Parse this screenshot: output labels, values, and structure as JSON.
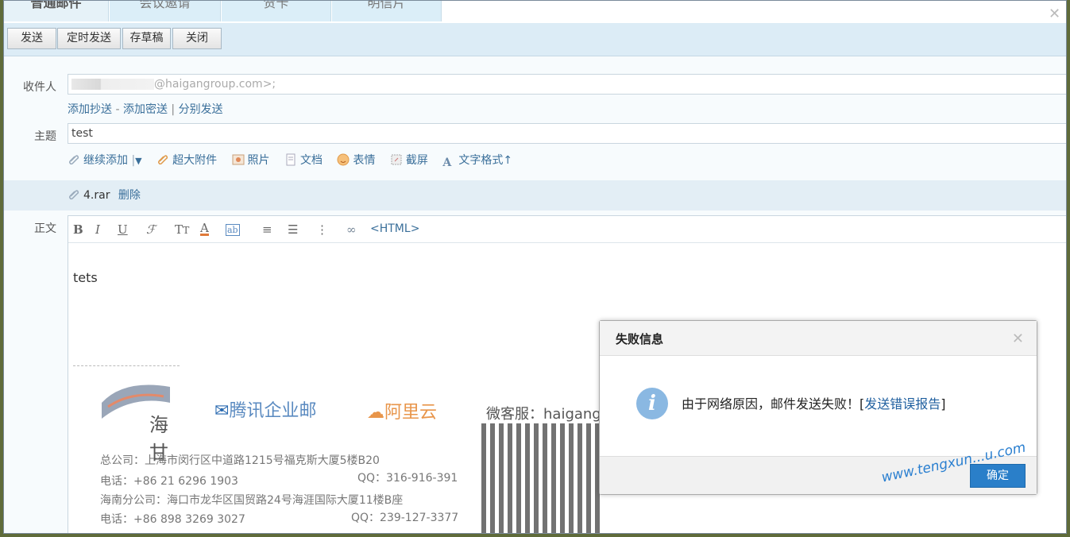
{
  "tabs": [
    "普通邮件",
    "会议邀请",
    "贺卡",
    "明信片"
  ],
  "toolbar": {
    "send": "发送",
    "scheduled_send": "定时发送",
    "save_draft": "存草稿",
    "close": "关闭"
  },
  "compose": {
    "to_label": "收件人",
    "to_value_suffix": "@haigangroup.com>;",
    "add_cc": "添加抄送",
    "dash": "-",
    "add_bcc": "添加密送",
    "pipe": "|",
    "separate_send": "分别发送",
    "subject_label": "主题",
    "subject_value": "test",
    "body_label": "正文",
    "body_text": "tets"
  },
  "attach_bar": {
    "continue_add": "继续添加",
    "large_attachment": "超大附件",
    "photo": "照片",
    "document": "文档",
    "emoji": "表情",
    "screenshot": "截屏",
    "text_format": "文字格式↑"
  },
  "attachment": {
    "filename": "4.rar",
    "delete": "删除"
  },
  "editor_toolbar": {
    "html": "<HTML>"
  },
  "signature": {
    "logo1": "海甘",
    "logo2": "腾讯企业邮",
    "logo3": "阿里云",
    "wechat": "微客服：haigang",
    "addr1": "总公司：上海市闵行区中道路1215号福克斯大厦5楼B20",
    "tel1": "电话：+86 21 6296 1903",
    "qq1": "QQ：316-916-391",
    "addr2": "海南分公司：海口市龙华区国贸路24号海涯国际大厦11楼B座",
    "tel2": "电话：+86 898 3269 3027",
    "qq2": "QQ：239-127-3377"
  },
  "dialog": {
    "title": "失败信息",
    "message": "由于网络原因，邮件发送失败！",
    "bracket_open": "[",
    "link": "发送错误报告",
    "bracket_close": "]",
    "ok": "确定"
  },
  "watermark": "www.tengxun...u.com"
}
